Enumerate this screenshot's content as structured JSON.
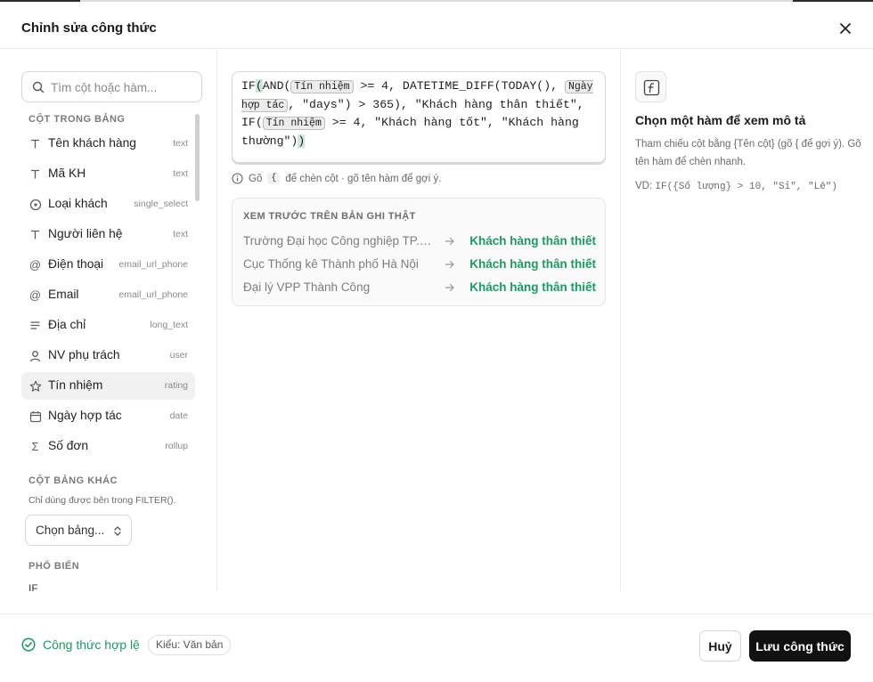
{
  "dialog": {
    "title": "Chỉnh sửa công thức",
    "close_icon": "close-icon"
  },
  "search": {
    "placeholder": "Tìm cột hoặc hàm..."
  },
  "table_columns": {
    "heading": "CỘT TRONG BẢNG",
    "items": [
      {
        "icon": "text-icon",
        "name": "Tên khách hàng",
        "type": "text"
      },
      {
        "icon": "text-icon",
        "name": "Mã KH",
        "type": "text"
      },
      {
        "icon": "single-select-icon",
        "name": "Loại khách",
        "type": "single_select"
      },
      {
        "icon": "text-icon",
        "name": "Người liên hệ",
        "type": "text"
      },
      {
        "icon": "at-icon",
        "name": "Điện thoại",
        "type": "email_url_phone"
      },
      {
        "icon": "at-icon",
        "name": "Email",
        "type": "email_url_phone"
      },
      {
        "icon": "long-text-icon",
        "name": "Địa chỉ",
        "type": "long_text"
      },
      {
        "icon": "user-icon",
        "name": "NV phụ trách",
        "type": "user"
      },
      {
        "icon": "star-icon",
        "name": "Tín nhiệm",
        "type": "rating"
      },
      {
        "icon": "calendar-icon",
        "name": "Ngày hợp tác",
        "type": "date"
      },
      {
        "icon": "sigma-icon",
        "name": "Số đơn",
        "type": "rollup"
      }
    ]
  },
  "other_tables": {
    "heading": "CỘT BẢNG KHÁC",
    "note": "Chỉ dùng được bên trong FILTER().",
    "select_value": "Chọn bảng..."
  },
  "popular": {
    "heading": "PHỔ BIẾN",
    "first_item": "IF"
  },
  "editor": {
    "p1": "IF",
    "p2": "(",
    "p3": "AND(",
    "chip1": "Tín nhiệm",
    "p4": " >= 4, DATETIME_DIFF(TODAY(),",
    "chip2": "Ngày hợp tác",
    "p5": ", \"days\") > 365), \"Khách hàng thân thiết\", IF(",
    "chip3": "Tín nhiệm",
    "p6": " >= 4, \"Khách hàng tốt\", \"Khách hàng thường\")",
    "p7": ")"
  },
  "hint": {
    "prefix": "Gõ",
    "key": "{",
    "suffix": "để chèn cột · gõ tên hàm để gợi ý."
  },
  "preview": {
    "heading": "XEM TRƯỚC TRÊN BẢN GHI THẬT",
    "rows": [
      {
        "source": "Trường Đại học Công nghiệp TP.HCM",
        "result": "Khách hàng thân thiết"
      },
      {
        "source": "Cục Thống kê Thành phố Hà Nội",
        "result": "Khách hàng thân thiết"
      },
      {
        "source": "Đại lý VPP Thành Công",
        "result": "Khách hàng thân thiết"
      }
    ]
  },
  "help": {
    "title": "Chọn một hàm để xem mô tả",
    "description": "Tham chiếu cột bằng {Tên cột} (gõ { để gợi ý). Gõ tên hàm để chèn nhanh.",
    "example_label": "VD:",
    "example_code": "IF({Số lượng} > 10, \"Sỉ\", \"Lẻ\")"
  },
  "footer": {
    "status": "Công thức hợp lệ",
    "type_badge": "Kiểu: Văn bản",
    "cancel_label": "Huỷ",
    "save_label": "Lưu công thức"
  },
  "colors": {
    "accent_green": "#1a9b62",
    "primary_button": "#111111"
  }
}
